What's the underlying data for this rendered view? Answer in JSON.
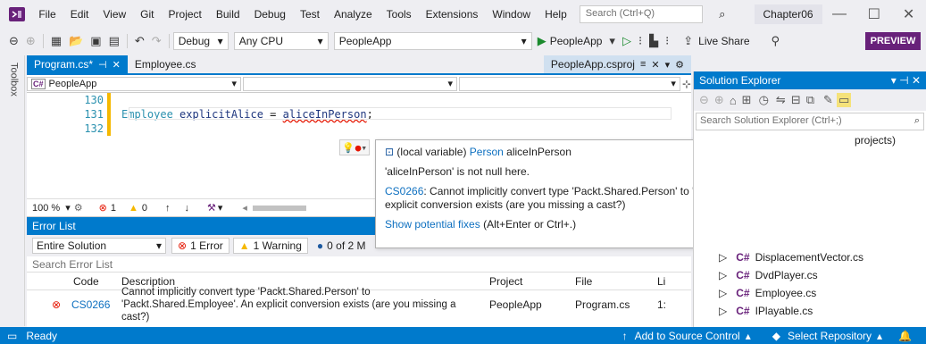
{
  "menu": {
    "items": [
      "File",
      "Edit",
      "View",
      "Git",
      "Project",
      "Build",
      "Debug",
      "Test",
      "Analyze",
      "Tools",
      "Extensions",
      "Window",
      "Help"
    ],
    "search_placeholder": "Search (Ctrl+Q)",
    "solution_name": "Chapter06"
  },
  "toolbar": {
    "config": "Debug",
    "platform": "Any CPU",
    "startup_project": "PeopleApp",
    "run_target": "PeopleApp",
    "live_share": "Live Share",
    "preview": "PREVIEW"
  },
  "toolbox_label": "Toolbox",
  "editor": {
    "tabs": [
      {
        "label": "Program.cs*",
        "active": true
      },
      {
        "label": "Employee.cs",
        "active": false
      }
    ],
    "right_tab": "PeopleApp.csproj",
    "nav_project": "PeopleApp",
    "lines": [
      {
        "num": "130",
        "text": ""
      },
      {
        "num": "131",
        "type": "Employee",
        "ident": "explicitAlice",
        "op": " = ",
        "value": "aliceInPerson",
        "end": ";"
      },
      {
        "num": "132",
        "text": ""
      }
    ],
    "zoom": "100 %",
    "errors": "1",
    "warnings": "0"
  },
  "quickinfo": {
    "var_label": "(local variable)",
    "var_type": "Person",
    "var_name": "aliceInPerson",
    "null_note": "'aliceInPerson' is not null here.",
    "code": "CS0266",
    "message": ": Cannot implicitly convert type 'Packt.Shared.Person' to 'Packt.Shared.Employee'. An explicit conversion exists (are you missing a cast?)",
    "fix_link": "Show potential fixes",
    "fix_shortcut": " (Alt+Enter or Ctrl+.)"
  },
  "errorlist": {
    "title": "Error List",
    "scope": "Entire Solution",
    "errors_pill": "1 Error",
    "warnings_pill": "1 Warning",
    "messages_pill": "0 of 2 M",
    "search_placeholder": "Search Error List",
    "headers": [
      "Code",
      "Description",
      "Project",
      "File",
      "Li"
    ],
    "rows": [
      {
        "code": "CS0266",
        "description": "Cannot implicitly convert type 'Packt.Shared.Person' to 'Packt.Shared.Employee'. An explicit conversion exists (are you missing a cast?)",
        "project": "PeopleApp",
        "file": "Program.cs",
        "line": "1:"
      }
    ]
  },
  "solution_explorer": {
    "title": "Solution Explorer",
    "search_placeholder": "Search Solution Explorer (Ctrl+;)",
    "partial_text": "projects)",
    "items": [
      "DisplacementVector.cs",
      "DvdPlayer.cs",
      "Employee.cs",
      "IPlayable.cs"
    ],
    "cs_glyph": "C#"
  },
  "statusbar": {
    "ready": "Ready",
    "add_source": "Add to Source Control",
    "select_repo": "Select Repository"
  },
  "colors": {
    "accent": "#007acc",
    "vs_purple": "#68217a",
    "error_red": "#e51400",
    "warning_yellow": "#f5b800"
  }
}
